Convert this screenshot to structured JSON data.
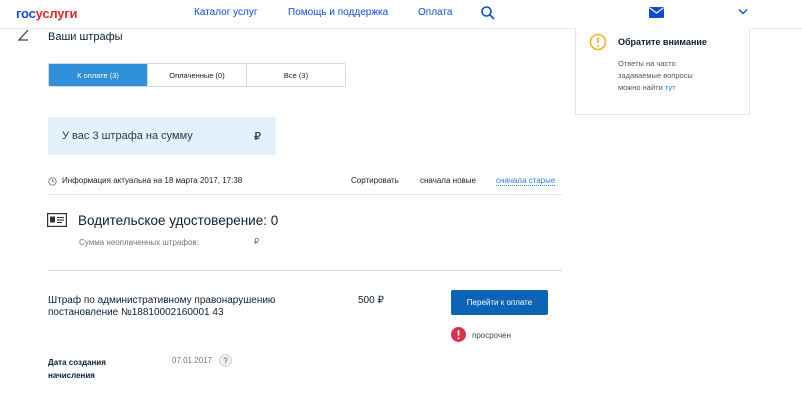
{
  "header": {
    "logo_part1": "гос",
    "logo_part2": "услуги",
    "nav": [
      "Каталог услуг",
      "Помощь и поддержка",
      "Оплата"
    ]
  },
  "page": {
    "title": "Ваши штрафы"
  },
  "tabs": [
    {
      "label": "К оплате (3)",
      "active": true
    },
    {
      "label": "Оплаченные (0)",
      "active": false
    },
    {
      "label": "Все (3)",
      "active": false
    }
  ],
  "summary": {
    "text": "У вас 3 штрафа на сумму",
    "currency": "₽"
  },
  "info": {
    "text": "Информация актуальна на 18 марта 2017, 17:38"
  },
  "sort": {
    "label": "Сортировать",
    "newest": "сначала новые",
    "oldest": "сначала старые"
  },
  "license": {
    "title": "Водительское удостоверение: 0",
    "unpaid_label": "Сумма неоплаченных штрафов:",
    "currency": "₽"
  },
  "fine": {
    "title_line1": "Штраф по административному правонарушению",
    "title_line2": "постановление №18810002160001 43",
    "amount": "500 ₽",
    "pay_label": "Перейти к оплате",
    "status": "просрочен",
    "date_label_line1": "Дата создания",
    "date_label_line2": "начисления",
    "date_value": "07.01.2017"
  },
  "notice": {
    "title": "Обратите внимание",
    "text_line1": "Ответы на часто",
    "text_line2": "задаваемые вопросы",
    "text_line3": "можно найти",
    "link": "тут"
  },
  "colors": {
    "brand_blue": "#0d4cd3",
    "brand_red": "#e3292e",
    "tab_active": "#2f8fd8",
    "button": "#0d64b6",
    "summary_bg": "#e4f1fb",
    "warning": "#f5b324",
    "overdue": "#d8334a"
  },
  "icons": [
    "search-icon",
    "mail-icon",
    "chevron-down-icon",
    "back-arrow-icon",
    "clock-icon",
    "id-card-icon",
    "overdue-icon",
    "help-icon",
    "warning-icon"
  ]
}
